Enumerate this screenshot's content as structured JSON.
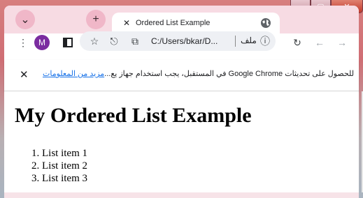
{
  "tab": {
    "title": "Ordered List Example"
  },
  "toolbar": {
    "avatar_letter": "M",
    "url": "C:/Users/bkar/D...",
    "file_label": "ملف"
  },
  "infobar": {
    "message": "للحصول على تحديثات Google Chrome في المستقبل، يجب استخدام جهاز يع...",
    "link": "مزيد من المعلومات"
  },
  "page": {
    "heading": "My Ordered List Example",
    "items": [
      "List item 1",
      "List item 2",
      "List item 3"
    ]
  },
  "icons": {
    "tab_search": "chevron-down-icon",
    "new_tab": "plus-icon",
    "tab_close": "close-icon",
    "site": "globe-icon",
    "menu": "kebab-menu-icon",
    "sidebar": "sidebar-icon",
    "bookmark": "star-icon",
    "share": "share-icon",
    "site_info": "info-icon",
    "reload": "reload-icon",
    "back": "arrow-left-icon",
    "forward": "arrow-right-icon",
    "infobar_close": "close-icon"
  },
  "colors": {
    "frame": "#cf6e74",
    "tabstrip": "#f7dbe3",
    "avatar": "#7b2ca0",
    "link": "#1a73e8"
  }
}
